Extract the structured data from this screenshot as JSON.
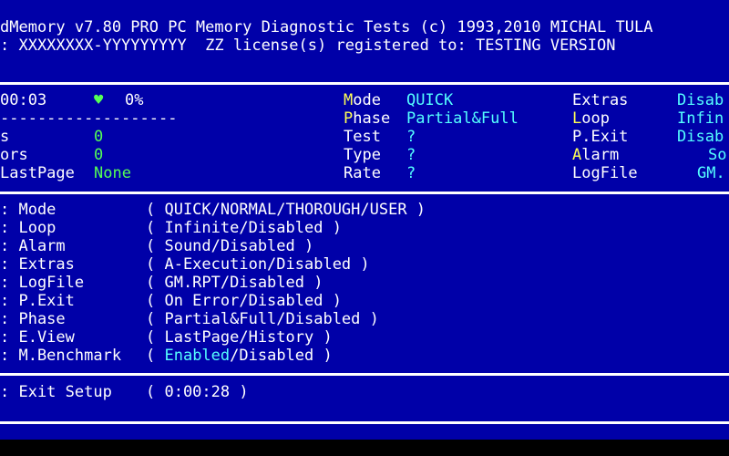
{
  "header": {
    "title_line": "dMemory v7.80 PRO PC Memory Diagnostic Tests (c) 1993,2010 MICHAL TULA",
    "license_line": ": XXXXXXXX-YYYYYYYYY  ZZ license(s) registered to: TESTING VERSION"
  },
  "status": {
    "time": "00:03",
    "heart": "♥",
    "percent": "0%",
    "dashes": "-------------------",
    "row1_label": "s",
    "row1_value": "0",
    "row2_label": "ors",
    "row2_value": "0",
    "lastpage_label": "LastPage",
    "lastpage_value": "None",
    "mode_label_hl": "M",
    "mode_label_rest": "ode",
    "mode_value": "QUICK",
    "phase_label_hl": "P",
    "phase_label_rest": "hase",
    "phase_value": "Partial&Full",
    "test_label": "Test",
    "test_value": "?",
    "type_label": "Type",
    "type_value": "?",
    "rate_label": "Rate",
    "rate_value": "?",
    "extras_label": "Extras",
    "extras_value": "Disab",
    "loop_label_hl": "L",
    "loop_label_rest": "oop",
    "loop_value": "Infin",
    "pexit_label": "P.Exit",
    "pexit_value": "Disab",
    "alarm_label_hl": "A",
    "alarm_label_rest": "larm",
    "alarm_value": "So",
    "logfile_label": "LogFile",
    "logfile_value": "GM."
  },
  "setup": {
    "items": [
      {
        "label": ": Mode",
        "options": "( QUICK/NORMAL/THOROUGH/USER )"
      },
      {
        "label": ": Loop",
        "options": "( Infinite/Disabled )"
      },
      {
        "label": ": Alarm",
        "options": "( Sound/Disabled )"
      },
      {
        "label": ": Extras",
        "options": "( A-Execution/Disabled )"
      },
      {
        "label": ": LogFile",
        "options": "( GM.RPT/Disabled )"
      },
      {
        "label": ": P.Exit",
        "options": "( On Error/Disabled )"
      },
      {
        "label": ": Phase",
        "options": "( Partial&Full/Disabled )"
      },
      {
        "label": ": E.View",
        "options": "( LastPage/History )"
      },
      {
        "label": ": M.Benchmark",
        "options_open": "( ",
        "options_selected": "Enabled",
        "options_rest": "/Disabled )"
      }
    ],
    "exit_label": ": Exit Setup",
    "exit_timer": "( 0:00:28 )"
  },
  "colors": {
    "background": "#0000a8",
    "text": "#ffffff",
    "highlight_yellow": "#ffff55",
    "highlight_cyan": "#55ffff",
    "highlight_green": "#55ff55"
  }
}
